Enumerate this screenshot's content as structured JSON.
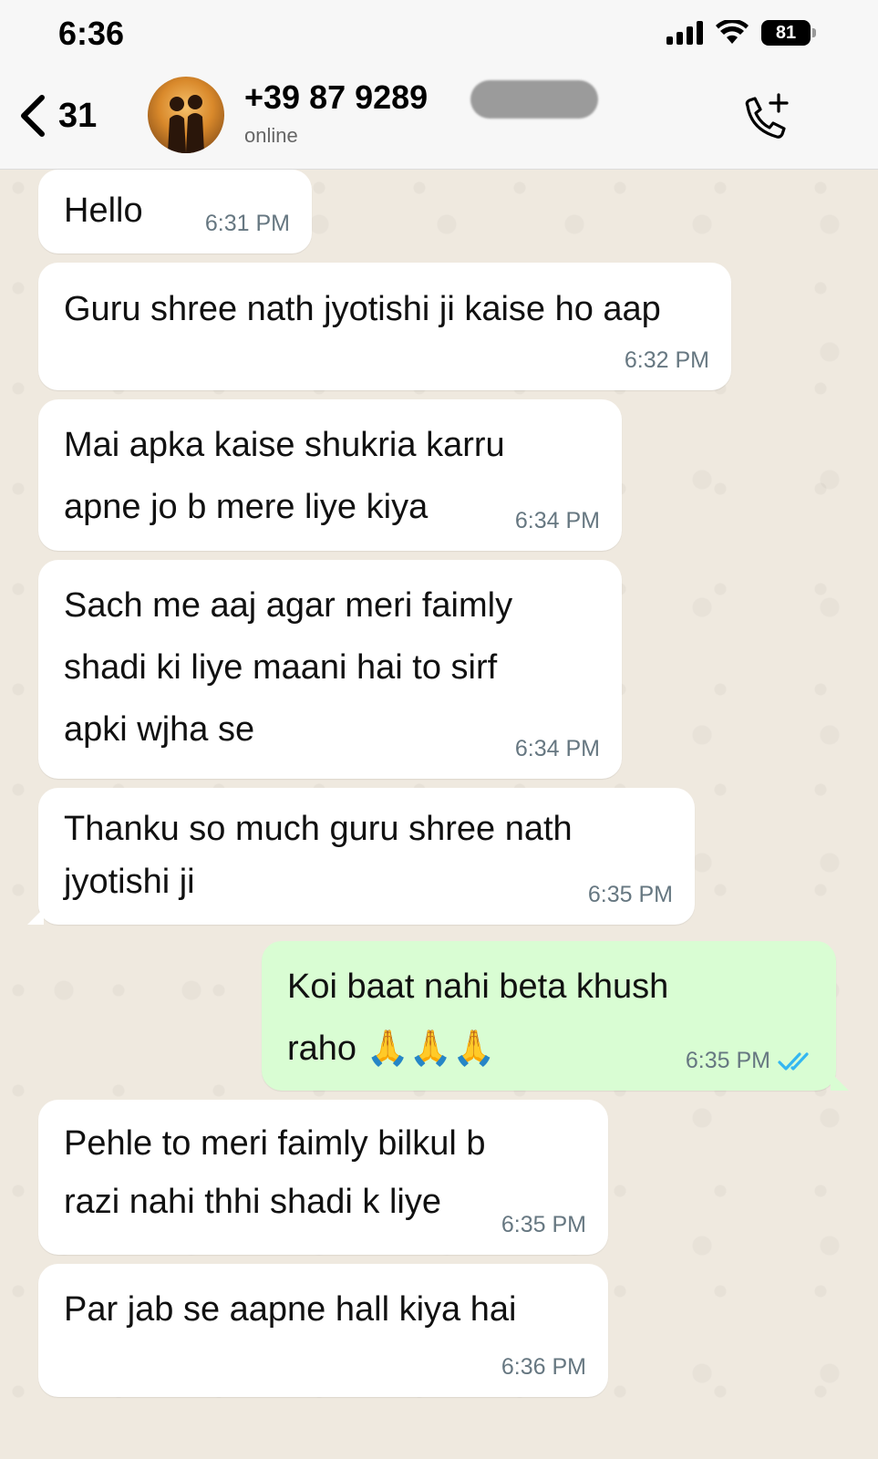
{
  "status_bar": {
    "time": "6:36",
    "battery": "81"
  },
  "header": {
    "back_count": "31",
    "contact_name": "+39 87 9289",
    "contact_status": "online"
  },
  "messages": [
    {
      "direction": "in",
      "text": "Hello",
      "time": "6:31 PM"
    },
    {
      "direction": "in",
      "text": "Guru shree nath jyotishi ji kaise ho aap",
      "time": "6:32 PM"
    },
    {
      "direction": "in",
      "text": "Mai apka kaise shukria karru\napne jo b mere liye kiya",
      "time": "6:34 PM"
    },
    {
      "direction": "in",
      "text": "Sach me aaj agar meri faimly\nshadi ki liye maani hai to sirf\napki wjha se",
      "time": "6:34 PM"
    },
    {
      "direction": "in",
      "text": "Thanku so much guru shree nath\njyotishi ji",
      "time": "6:35 PM"
    },
    {
      "direction": "out",
      "text": "Koi baat nahi beta khush\nraho 🙏🙏🙏",
      "time": "6:35 PM",
      "read": true
    },
    {
      "direction": "in",
      "text": "Pehle to meri faimly bilkul b\nrazi nahi thhi shadi k liye",
      "time": "6:35 PM"
    },
    {
      "direction": "in",
      "text": "Par jab se aapne hall kiya hai",
      "time": "6:36 PM"
    }
  ],
  "colors": {
    "incoming_bubble": "#ffffff",
    "outgoing_bubble": "#d9fdd3",
    "read_receipt": "#34b7f1",
    "chat_background": "#efe9df"
  }
}
